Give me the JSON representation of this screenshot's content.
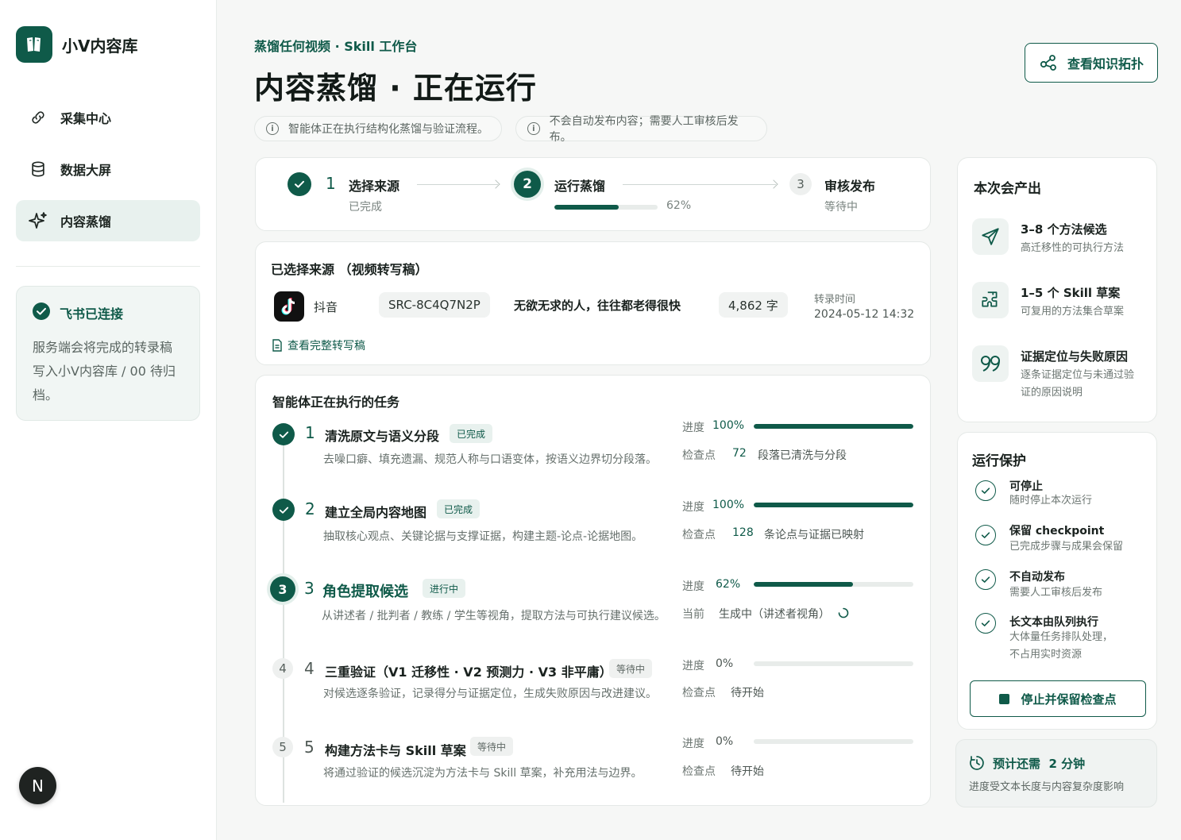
{
  "app": {
    "name": "小V内容库"
  },
  "sidebar": {
    "items": [
      {
        "label": "采集中心",
        "icon": "link-icon"
      },
      {
        "label": "数据大屏",
        "icon": "database-icon"
      },
      {
        "label": "内容蒸馏",
        "icon": "sparkle-icon",
        "active": true
      }
    ],
    "connection": {
      "title": "飞书已连接",
      "text": "服务端会将完成的转录稿写入小V内容库 / 00 待归档。"
    },
    "user_initial": "N"
  },
  "header": {
    "breadcrumb": "蒸馏任何视频 · Skill 工作台",
    "title": "内容蒸馏 · 正在运行",
    "topology_button": "查看知识拓扑",
    "notices": [
      "智能体正在执行结构化蒸馏与验证流程。",
      "不会自动发布内容；需要人工审核后发布。"
    ]
  },
  "stepper": {
    "steps": [
      {
        "num": "1",
        "title": "选择来源",
        "sub": "已完成"
      },
      {
        "num": "2",
        "title": "运行蒸馏",
        "progress": 0.62,
        "progress_label": "62%"
      },
      {
        "num": "3",
        "title": "审核发布",
        "sub": "等待中"
      }
    ]
  },
  "source": {
    "title": "已选择来源 （视频转写稿）",
    "platform": "抖音",
    "id": "SRC-8C4Q7N2P",
    "video_title": "无欲无求的人，往往都老得很快",
    "word_count": "4,862 字",
    "time_label": "转录时间",
    "time_value": "2024-05-12 14:32",
    "link": "查看完整转写稿"
  },
  "tasks": {
    "title": "智能体正在执行的任务",
    "progress_label": "进度",
    "items": [
      {
        "num": "1",
        "title": "清洗原文与语义分段",
        "badge": "已完成",
        "desc": "去噪口癖、填充遗漏、规范人称与口语变体，按语义边界切分段落。",
        "progress": 1.0,
        "progress_text": "100%",
        "meta_label": "检查点",
        "meta_value": "72",
        "meta_text": "段落已清洗与分段"
      },
      {
        "num": "2",
        "title": "建立全局内容地图",
        "badge": "已完成",
        "desc": "抽取核心观点、关键论据与支撑证据，构建主题-论点-论据地图。",
        "progress": 1.0,
        "progress_text": "100%",
        "meta_label": "检查点",
        "meta_value": "128",
        "meta_text": "条论点与证据已映射"
      },
      {
        "num": "3",
        "title": "角色提取候选",
        "badge": "进行中",
        "desc": "从讲述者 / 批判者 / 教练 / 学生等视角，提取方法与可执行建议候选。",
        "progress": 0.62,
        "progress_text": "62%",
        "meta_label": "当前",
        "meta_value": "",
        "meta_text": "生成中（讲述者视角）"
      },
      {
        "num": "4",
        "title": "三重验证（V1 迁移性 · V2 预测力 · V3 非平庸）",
        "badge": "等待中",
        "desc": "对候选逐条验证，记录得分与证据定位，生成失败原因与改进建议。",
        "progress": 0.0,
        "progress_text": "0%",
        "meta_label": "检查点",
        "meta_value": "",
        "meta_text": "待开始"
      },
      {
        "num": "5",
        "title": "构建方法卡与 Skill 草案",
        "badge": "等待中",
        "desc": "将通过验证的候选沉淀为方法卡与 Skill 草案，补充用法与边界。",
        "progress": 0.0,
        "progress_text": "0%",
        "meta_label": "检查点",
        "meta_value": "",
        "meta_text": "待开始"
      }
    ]
  },
  "outputs": {
    "title": "本次会产出",
    "items": [
      {
        "title": "3–8 个方法候选",
        "sub": "高迁移性的可执行方法",
        "icon": "send-icon"
      },
      {
        "title": "1–5 个 Skill 草案",
        "sub": "可复用的方法集合草案",
        "icon": "puzzle-icon"
      },
      {
        "title": "证据定位与失败原因",
        "sub": "逐条证据定位与未通过验证的原因说明",
        "icon": "quote-icon"
      }
    ]
  },
  "guard": {
    "title": "运行保护",
    "items": [
      {
        "title": "可停止",
        "sub": "随时停止本次运行"
      },
      {
        "title": "保留 checkpoint",
        "sub": "已完成步骤与成果会保留"
      },
      {
        "title": "不自动发布",
        "sub": "需要人工审核后发布"
      },
      {
        "title": "长文本由队列执行",
        "sub": "大体量任务排队处理，不占用实时资源"
      }
    ],
    "stop_button": "停止并保留检查点"
  },
  "eta": {
    "title": "预计还需  2 分钟",
    "sub": "进度受文本长度与内容复杂度影响"
  },
  "colors": {
    "accent": "#0f5a49",
    "accent_light": "#e8f1ee"
  }
}
